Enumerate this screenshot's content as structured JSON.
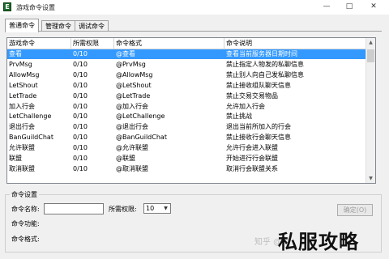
{
  "window": {
    "title": "游戏命令设置",
    "icon_label": "E"
  },
  "tabs": [
    "普通命令",
    "管理命令",
    "调试命令"
  ],
  "grid": {
    "columns": [
      "游戏命令",
      "所需权限",
      "命令格式",
      "命令说明"
    ],
    "rows": [
      [
        "查看",
        "0/10",
        "@查看",
        "查看当前服务器日期时间"
      ],
      [
        "PrvMsg",
        "0/10",
        "@PrvMsg",
        "禁止指定人物发的私聊信息"
      ],
      [
        "AllowMsg",
        "0/10",
        "@AllowMsg",
        "禁止别人向自己发私聊信息"
      ],
      [
        "LetShout",
        "0/10",
        "@LetShout",
        "禁止接收组队聊天信息"
      ],
      [
        "LetTrade",
        "0/10",
        "@LetTrade",
        "禁止交易交易物品"
      ],
      [
        "加入行会",
        "0/10",
        "@加入行会",
        "允许加入行会"
      ],
      [
        "LetChallenge",
        "0/10",
        "@LetChallenge",
        "禁止挑战"
      ],
      [
        "退出行会",
        "0/10",
        "@退出行会",
        "退出当前所加入的行会"
      ],
      [
        "BanGuildChat",
        "0/10",
        "@BanGuildChat",
        "禁止接收行会聊天信息"
      ],
      [
        "允许联盟",
        "0/10",
        "@允许联盟",
        "允许行会进入联盟"
      ],
      [
        "联盟",
        "0/10",
        "@联盟",
        "开始进行行会联盟"
      ],
      [
        "取消联盟",
        "0/10",
        "@取消联盟",
        "取消行会联盟关系"
      ]
    ],
    "selected_row": 0
  },
  "settings": {
    "group_title": "命令设置",
    "name_label": "命令名称:",
    "name_value": "",
    "perm_label": "所需权限:",
    "perm_value": "10",
    "func_label": "命令功能:",
    "format_label": "命令格式:",
    "ok_button": "确定(O)"
  },
  "watermark": {
    "small": "知乎 @",
    "big": "私服攻略"
  }
}
